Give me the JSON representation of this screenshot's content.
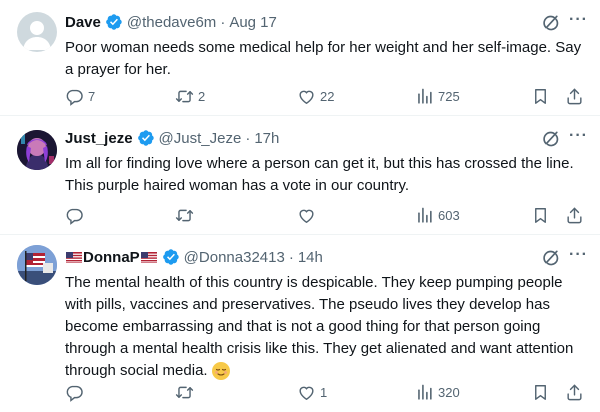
{
  "tweets": [
    {
      "name": "Dave",
      "handle": "@thedave6m",
      "separator": "·",
      "time": "Aug 17",
      "text": "Poor woman needs some medical help for her weight and her self-image. Say a prayer for her.",
      "replies": "7",
      "retweets": "2",
      "likes": "22",
      "views": "725"
    },
    {
      "name": "Just_jeze",
      "handle": "@Just_Jeze",
      "separator": "·",
      "time": "17h",
      "text": "Im all for finding love where a person can get it, but this has crossed the line. This purple haired woman has a vote in our country.",
      "replies": "",
      "retweets": "",
      "likes": "",
      "views": "603"
    },
    {
      "name": "DonnaP",
      "handle": "@Donna32413",
      "separator": "·",
      "time": "14h",
      "text": "The mental health of this country is despicable.  They keep pumping people with pills, vaccines and preservatives.  The pseudo lives they develop has become embarrassing and that is not a good thing for that person going through a mental health crisis like this.  They get alienated and want attention through social media.",
      "emoji": "relieved-face-emoji",
      "replies": "",
      "retweets": "",
      "likes": "1",
      "views": "320"
    }
  ],
  "icons": [
    "verified-badge-icon",
    "grok-icon",
    "more-icon",
    "reply-icon",
    "retweet-icon",
    "like-icon",
    "views-icon",
    "bookmark-icon",
    "share-icon",
    "us-flag-icon"
  ],
  "colors": {
    "verified": "#1d9bf0",
    "text": "#0f1419",
    "muted": "#536471",
    "divider": "#eff3f4"
  }
}
